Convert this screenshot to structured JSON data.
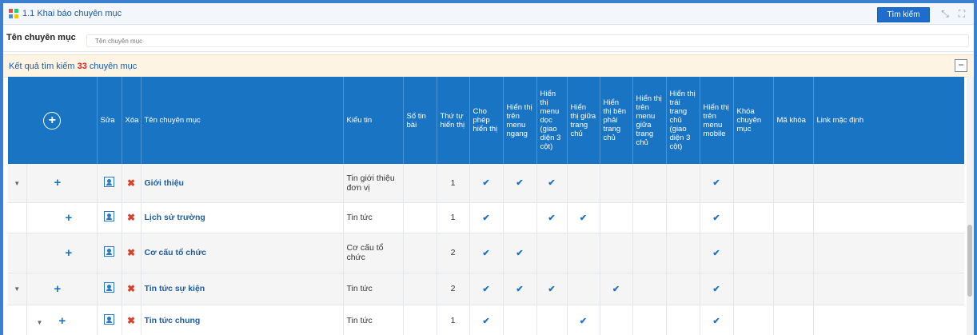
{
  "title": "1.1 Khai báo chuyên mục",
  "search_button": "Tìm kiếm",
  "filter": {
    "label": "Tên chuyên mục",
    "placeholder": "Tên chuyên mục"
  },
  "results": {
    "prefix": "Kết quả tìm kiếm",
    "count": "33",
    "suffix": "chuyên mục"
  },
  "table": {
    "headers": {
      "sua": "Sửa",
      "xoa": "Xóa",
      "ten": "Tên chuyên mục",
      "kieu": "Kiểu tin",
      "sotin": "Số tin bài",
      "thutu": "Thứ tự hiển thị",
      "cho": "Cho phép hiển thị",
      "ngang": "Hiển thị trên menu ngang",
      "doc": "Hiển thị menu dọc (giao diện 3 cột)",
      "giua": "Hiển thị giữa trang chủ",
      "phai": "Hiển thị bên phải trang chủ",
      "menugiua": "Hiển thị trên menu giữa trang chủ",
      "trai": "Hiển thị trái trang chủ (giao diện 3 cột)",
      "mobile": "Hiển thị trên menu mobile",
      "khoa": "Khóa chuyên mục",
      "makhoa": "Mã khóa",
      "link": "Link mặc định"
    },
    "check_glyph": "✔",
    "rows": [
      {
        "name": "Giới thiệu",
        "kieu": "Tin giới thiệu đơn vị",
        "thutu": "1",
        "checks": [
          true,
          true,
          true,
          false,
          false,
          false,
          false,
          true
        ]
      },
      {
        "name": "Lịch sử trường",
        "kieu": "Tin tức",
        "thutu": "1",
        "checks": [
          true,
          false,
          true,
          true,
          false,
          false,
          false,
          true
        ]
      },
      {
        "name": "Cơ cấu tổ chức",
        "kieu": "Cơ cấu tổ chức",
        "thutu": "2",
        "checks": [
          true,
          true,
          false,
          false,
          false,
          false,
          false,
          true
        ]
      },
      {
        "name": "Tin tức sự kiện",
        "kieu": "Tin tức",
        "thutu": "2",
        "checks": [
          true,
          true,
          true,
          false,
          true,
          false,
          false,
          true
        ]
      },
      {
        "name": "Tin tức chung",
        "kieu": "Tin tức",
        "thutu": "1",
        "checks": [
          true,
          false,
          false,
          true,
          false,
          false,
          false,
          true
        ]
      }
    ]
  }
}
